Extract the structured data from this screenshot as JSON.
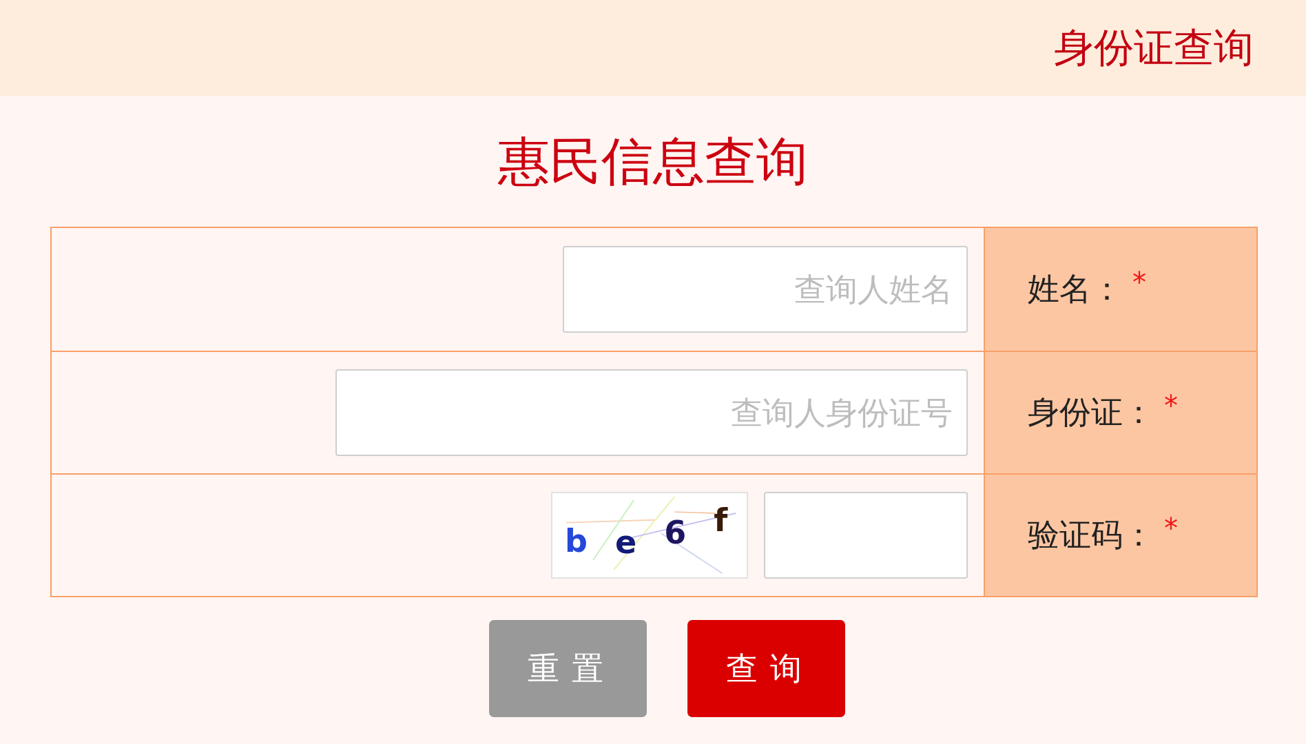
{
  "header": {
    "title": "身份证查询"
  },
  "form": {
    "title": "惠民信息查询",
    "rows": [
      {
        "kind": "text",
        "label": "姓名：",
        "mark": "*",
        "placeholder": "查询人姓名"
      },
      {
        "kind": "text",
        "label": "身份证：",
        "mark": "*",
        "placeholder": "查询人身份证号"
      },
      {
        "kind": "captcha",
        "label": "验证码：",
        "mark": "*",
        "captcha": [
          {
            "text": "b",
            "color": "#2448d8"
          },
          {
            "text": "e",
            "color": "#141a78"
          },
          {
            "text": "6",
            "color": "#1c1660"
          },
          {
            "text": "f",
            "color": "#3a1a08"
          }
        ]
      }
    ]
  },
  "buttons": [
    {
      "kind": "reset",
      "label": "重置"
    },
    {
      "kind": "submit",
      "label": "查询"
    }
  ]
}
